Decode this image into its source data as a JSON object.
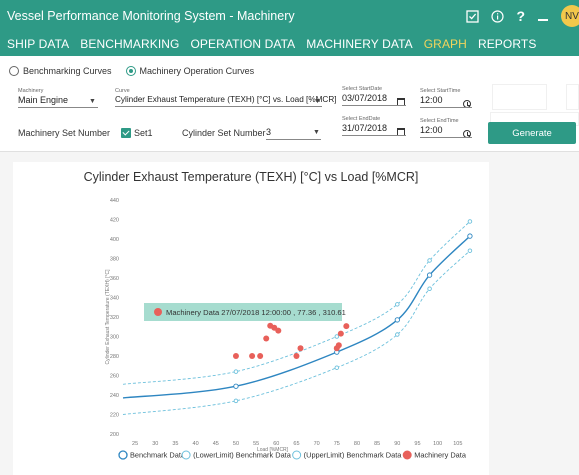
{
  "app": {
    "title": "Vessel Performance Monitoring System - Machinery",
    "avatar_initials": "NV",
    "icons": [
      "checkbox-icon",
      "info-icon",
      "help-icon",
      "minimize-icon"
    ]
  },
  "nav": {
    "items": [
      {
        "label": "SHIP DATA",
        "active": false
      },
      {
        "label": "BENCHMARKING",
        "active": false
      },
      {
        "label": "OPERATION DATA",
        "active": false
      },
      {
        "label": "MACHINERY DATA",
        "active": false
      },
      {
        "label": "GRAPH",
        "active": true
      },
      {
        "label": "REPORTS",
        "active": false
      }
    ]
  },
  "filters": {
    "radio_benchmarking": "Benchmarking Curves",
    "radio_operation": "Machinery Operation Curves",
    "selected_radio": "operation",
    "machinery": {
      "label": "Machinery",
      "value": "Main Engine"
    },
    "curve": {
      "label": "Curve",
      "value": "Cylinder Exhaust Temperature (TEXH) [°C]  vs. Load [%MCR]"
    },
    "start_date": {
      "label": "Select StartDate",
      "value": "03/07/2018"
    },
    "start_time": {
      "label": "Select StartTime",
      "value": "12:00"
    },
    "end_date": {
      "label": "Select EndDate",
      "value": "31/07/2018"
    },
    "end_time": {
      "label": "Select EndTime",
      "value": "12:00"
    },
    "machinery_set_label": "Machinery Set Number",
    "set_checkbox_label": "Set1",
    "set_checked": true,
    "cylinder_set_label": "Cylinder Set Number",
    "cylinder_set_value": "3",
    "generate_label": "Generate"
  },
  "colors": {
    "primary": "#2e9a86",
    "active_nav": "#f2d45c",
    "benchmark_line": "#2e86c1",
    "limit_line": "#6cc0dc",
    "machinery_point": "#e8605a",
    "tooltip_bg": "#a6dccf"
  },
  "chart_data": {
    "type": "scatter",
    "title": "Cylinder Exhaust Temperature (TEXH) [°C]  vs Load [%MCR]",
    "xlabel": "Load [%MCR]",
    "ylabel": "Cylinder Exhaust Temperature (TEXH) [°C]",
    "xlim": [
      22,
      110
    ],
    "ylim": [
      200,
      440
    ],
    "xticks": [
      25,
      30,
      35,
      40,
      45,
      50,
      55,
      60,
      65,
      70,
      75,
      80,
      85,
      90,
      95,
      100,
      105
    ],
    "yticks": [
      200,
      220,
      240,
      260,
      280,
      300,
      320,
      340,
      360,
      380,
      400,
      420,
      440
    ],
    "grid": false,
    "legend_position": "bottom",
    "series": [
      {
        "name": "Benchmark Data",
        "style": "line",
        "x": [
          22,
          50,
          75,
          90,
          98,
          108
        ],
        "y": [
          237,
          249,
          284,
          317,
          363,
          403
        ]
      },
      {
        "name": "(LowerLimit) Benchmark Data",
        "style": "dashed",
        "x": [
          22,
          50,
          75,
          90,
          98,
          108
        ],
        "y": [
          220,
          234,
          268,
          302,
          349,
          388
        ]
      },
      {
        "name": "(UpperLimit) Benchmark Data",
        "style": "dashed",
        "x": [
          22,
          50,
          75,
          90,
          98,
          108
        ],
        "y": [
          251,
          264,
          300,
          333,
          378,
          418
        ]
      },
      {
        "name": "Machinery Data",
        "style": "points",
        "x": [
          50,
          54,
          56,
          57.5,
          58.5,
          59.5,
          60.5,
          65,
          66,
          75,
          75.5,
          76,
          77.36
        ],
        "y": [
          280,
          280,
          280,
          298,
          311,
          309,
          306,
          280,
          288,
          288,
          291,
          303,
          310.61
        ]
      }
    ],
    "tooltip": {
      "text": "Machinery Data 27/07/2018 12:00:00 , 77.36 , 310.61"
    }
  }
}
